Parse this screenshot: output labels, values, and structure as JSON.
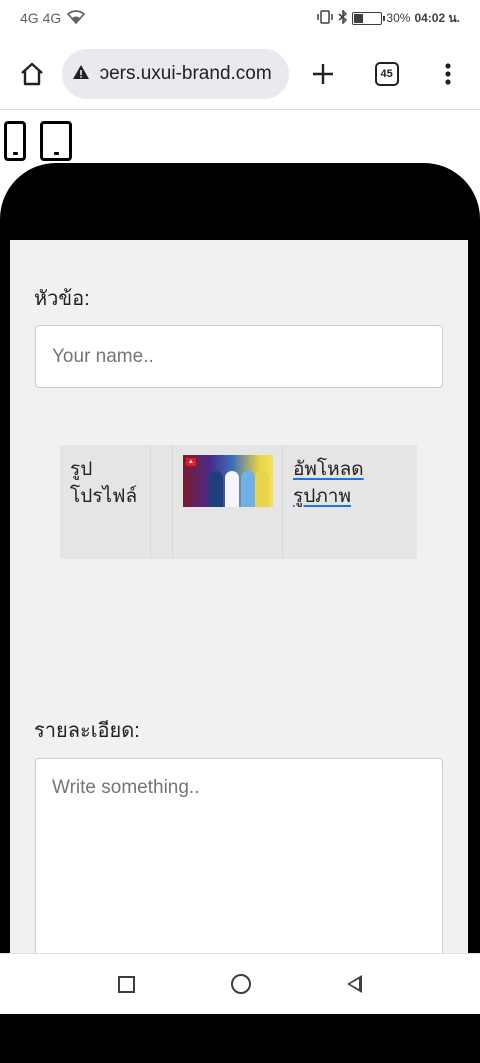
{
  "status_bar": {
    "network": "4G 4G",
    "battery_percent": "30%",
    "battery_level": 0.3,
    "time": "04:02 น."
  },
  "browser": {
    "url": "ɔers.uxui-brand.com",
    "tab_count": "45",
    "icons": {
      "home": "home-icon",
      "warning": "warning-icon",
      "new_tab": "plus-icon",
      "menu": "more-vert-icon"
    }
  },
  "device_toggle": {
    "icons": [
      "phone-icon",
      "tablet-icon"
    ]
  },
  "form": {
    "title_label": "หัวข้อ:",
    "name_placeholder": "Your name..",
    "profile_label": "รูปโปรไฟล์",
    "upload_link": "อัพโหลดรูปภาพ",
    "details_label": "รายละเอียด:",
    "details_placeholder": "Write something.."
  },
  "colors": {
    "link_underline": "#1a73e8",
    "frame": "#000000",
    "screen_bg": "#f1f1f1"
  }
}
